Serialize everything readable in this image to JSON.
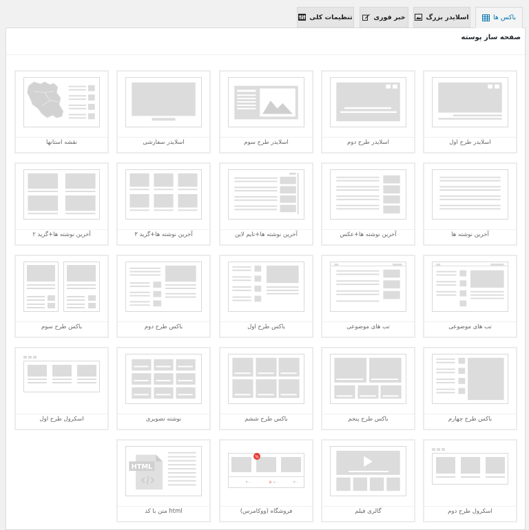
{
  "tabs": [
    {
      "label": "باکس ها",
      "icon": "table-icon",
      "active": true
    },
    {
      "label": "اسلایدر بزرگ",
      "icon": "image-icon",
      "active": false
    },
    {
      "label": "خبر فوری",
      "icon": "pencil-icon",
      "active": false
    },
    {
      "label": "تنظیمات کلی",
      "icon": "settings-icon",
      "active": false
    }
  ],
  "panel": {
    "title": "صفحه ساز پوسته"
  },
  "cards": [
    {
      "label": "اسلایدر طرح اول",
      "icon": "slider-1-icon"
    },
    {
      "label": "اسلایدر طرح دوم",
      "icon": "slider-2-icon"
    },
    {
      "label": "اسلایدر طرح سوم",
      "icon": "slider-3-icon"
    },
    {
      "label": "اسلایدر سفارشی",
      "icon": "custom-slider-icon"
    },
    {
      "label": "نقشه استانها",
      "icon": "iran-map-icon"
    },
    {
      "label": "آخرین نوشته ها",
      "icon": "latest-posts-icon"
    },
    {
      "label": "آخرین نوشته ها+عکس",
      "icon": "latest-posts-image-icon"
    },
    {
      "label": "آخرین نوشته ها+تایم لاین",
      "icon": "latest-posts-timeline-icon"
    },
    {
      "label": "آخرین نوشته ها+گرید ۳",
      "icon": "grid-3-icon"
    },
    {
      "label": "آخرین نوشته ها+گرید ۲",
      "icon": "grid-2-icon"
    },
    {
      "label": "تب های موضوعی",
      "icon": "topic-tabs-1-icon"
    },
    {
      "label": "تب های موضوعی",
      "icon": "topic-tabs-2-icon"
    },
    {
      "label": "باکس طرح اول",
      "icon": "box-1-icon"
    },
    {
      "label": "باکس طرح دوم",
      "icon": "box-2-icon"
    },
    {
      "label": "باکس طرح سوم",
      "icon": "box-3-icon"
    },
    {
      "label": "باکس طرح چهارم",
      "icon": "box-4-icon"
    },
    {
      "label": "باکس طرح پنجم",
      "icon": "box-5-icon"
    },
    {
      "label": "باکس طرح ششم",
      "icon": "box-6-icon"
    },
    {
      "label": "نوشته تصویری",
      "icon": "image-post-icon"
    },
    {
      "label": "اسکرول طرح اول",
      "icon": "scroll-1-icon"
    },
    {
      "label": "اسکرول طرح دوم",
      "icon": "scroll-2-icon"
    },
    {
      "label": "گالری فیلم",
      "icon": "video-gallery-icon"
    },
    {
      "label": "فروشگاه (ووکامرس)",
      "icon": "woocommerce-icon"
    },
    {
      "label": "متن با کد html",
      "icon": "html-code-icon",
      "thumb_text": "HTML"
    }
  ],
  "woo_prices": [
    "۲۰۰",
    "۵۰۰",
    "۱۰۰",
    "۲۰۰"
  ],
  "colors": {
    "accent": "#0073aa",
    "sale_badge": "#e53935",
    "placeholder": "#dcdcdc"
  }
}
